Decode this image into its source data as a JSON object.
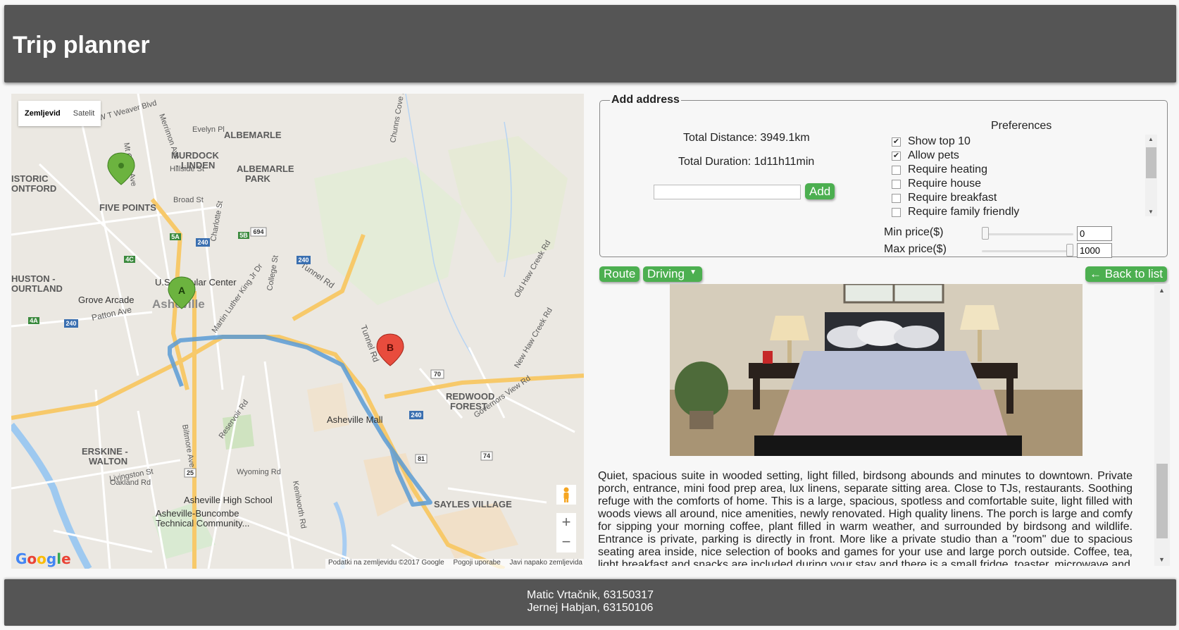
{
  "header": {
    "title": "Trip planner"
  },
  "map": {
    "type_control": {
      "map_label": "Zemljevid",
      "satellite_label": "Satelit"
    },
    "zoom_in": "+",
    "zoom_out": "−",
    "logo": "Google",
    "footer": {
      "data": "Podatki na zemljevidu ©2017 Google",
      "terms": "Pogoji uporabe",
      "report": "Javi napako zemljevida"
    },
    "markers": {
      "a": "A",
      "b": "B"
    },
    "labels": {
      "albemarle": "ALBEMARLE",
      "murdock": "MURDOCK",
      "linden": "- LINDEN",
      "albemarle_park_1": "ALBEMARLE",
      "albemarle_park_2": "PARK",
      "historic_1": "ISTORIC",
      "historic_2": "ONTFORD",
      "five_points": "FIVE POINTS",
      "huston_1": "HUSTON -",
      "huston_2": "OURTLAND",
      "us_cellular": "U.S. Cellular Center",
      "grove_arcade": "Grove Arcade",
      "asheville": "Asheville",
      "patton": "Patton Ave",
      "tunnel": "Tunnel Rd",
      "tunnel2": "Tunnel Rd",
      "redwood_1": "REDWOOD",
      "redwood_2": "FOREST",
      "mall": "Asheville Mall",
      "erskine_1": "ERSKINE -",
      "erskine_2": "WALTON",
      "high_school": "Asheville High School",
      "abtcc_1": "Asheville-Buncombe",
      "abtcc_2": "Technical Community...",
      "sayles": "SAYLES VILLAGE",
      "broad": "Broad St",
      "hillside": "Hillside St",
      "charlotte": "Charlotte St",
      "mlk": "Martin Luther King Jr Dr",
      "college": "College St",
      "biltmore": "Biltmore Ave",
      "oakland": "Oakland Rd",
      "reservoir": "Reservoir Rd",
      "weaver": "W T Weaver Blvd",
      "evelyn": "Evelyn Pl",
      "chunns": "Chunns Cove Rd",
      "old_haw": "Old Haw Creek Rd",
      "new_haw": "New Haw Creek Rd",
      "governors": "Governors View Rd",
      "wyoming": "Wyoming Rd",
      "kenilworth": "Kenilworth Rd",
      "livingston": "Livingston St",
      "mt_clare": "Mt Clare Ave",
      "merrimon": "Merrimon Ave",
      "hwy_240": "240",
      "hwy_70": "70",
      "hwy_25": "25",
      "hwy_81": "81",
      "hwy_694": "694",
      "hwy_74": "74",
      "exit_5a": "5A",
      "exit_5b": "5B",
      "exit_4c": "4C",
      "exit_4a": "4A"
    }
  },
  "address_panel": {
    "legend": "Add address",
    "total_distance": "Total Distance: 3949.1km",
    "total_duration": "Total Duration: 1d11h11min",
    "address_input": {
      "value": "",
      "placeholder": ""
    },
    "add_button": "Add",
    "preferences": {
      "title": "Preferences",
      "items": [
        {
          "label": "Show top 10",
          "checked": true
        },
        {
          "label": "Allow pets",
          "checked": true
        },
        {
          "label": "Require heating",
          "checked": false
        },
        {
          "label": "Require house",
          "checked": false
        },
        {
          "label": "Require breakfast",
          "checked": false
        },
        {
          "label": "Require family friendly",
          "checked": false
        }
      ],
      "min_price_label": "Min price($)",
      "max_price_label": "Max price($)",
      "min_price_value": "0",
      "max_price_value": "1000"
    }
  },
  "controls": {
    "route_button": "Route",
    "mode_select": "Driving",
    "back_button": "← Back to list"
  },
  "listing": {
    "description": "Quiet, spacious suite in wooded setting, light filled, birdsong abounds and minutes to downtown. Private porch, entrance, mini food prep area, lux linens, separate sitting area. Close to TJs, restaurants. Soothing refuge with the comforts of home. This is a large, spacious, spotless and comfortable suite, light filled with woods views all around, nice amenities, newly renovated. High quality linens. The porch is large and comfy for sipping your morning coffee, plant filled in warm weather, and surrounded by birdsong and wildlife. Entrance is private, parking is directly in front. More like a private studio than a \"room\" due to spacious seating area inside, nice selection of books and games for your use and large porch outside. Coffee, tea, light breakfast and snacks are included during your stay and there is a small fridge, toaster, microwave and"
  },
  "footer": {
    "line1": "Matic Vrtačnik, 63150317",
    "line2": "Jernej Habjan, 63150106"
  },
  "colors": {
    "header_bg": "#555555",
    "accent_green": "#4caf50",
    "route_blue": "#5b9bd5",
    "marker_green": "#6cb33f",
    "marker_red": "#e84c3d"
  }
}
